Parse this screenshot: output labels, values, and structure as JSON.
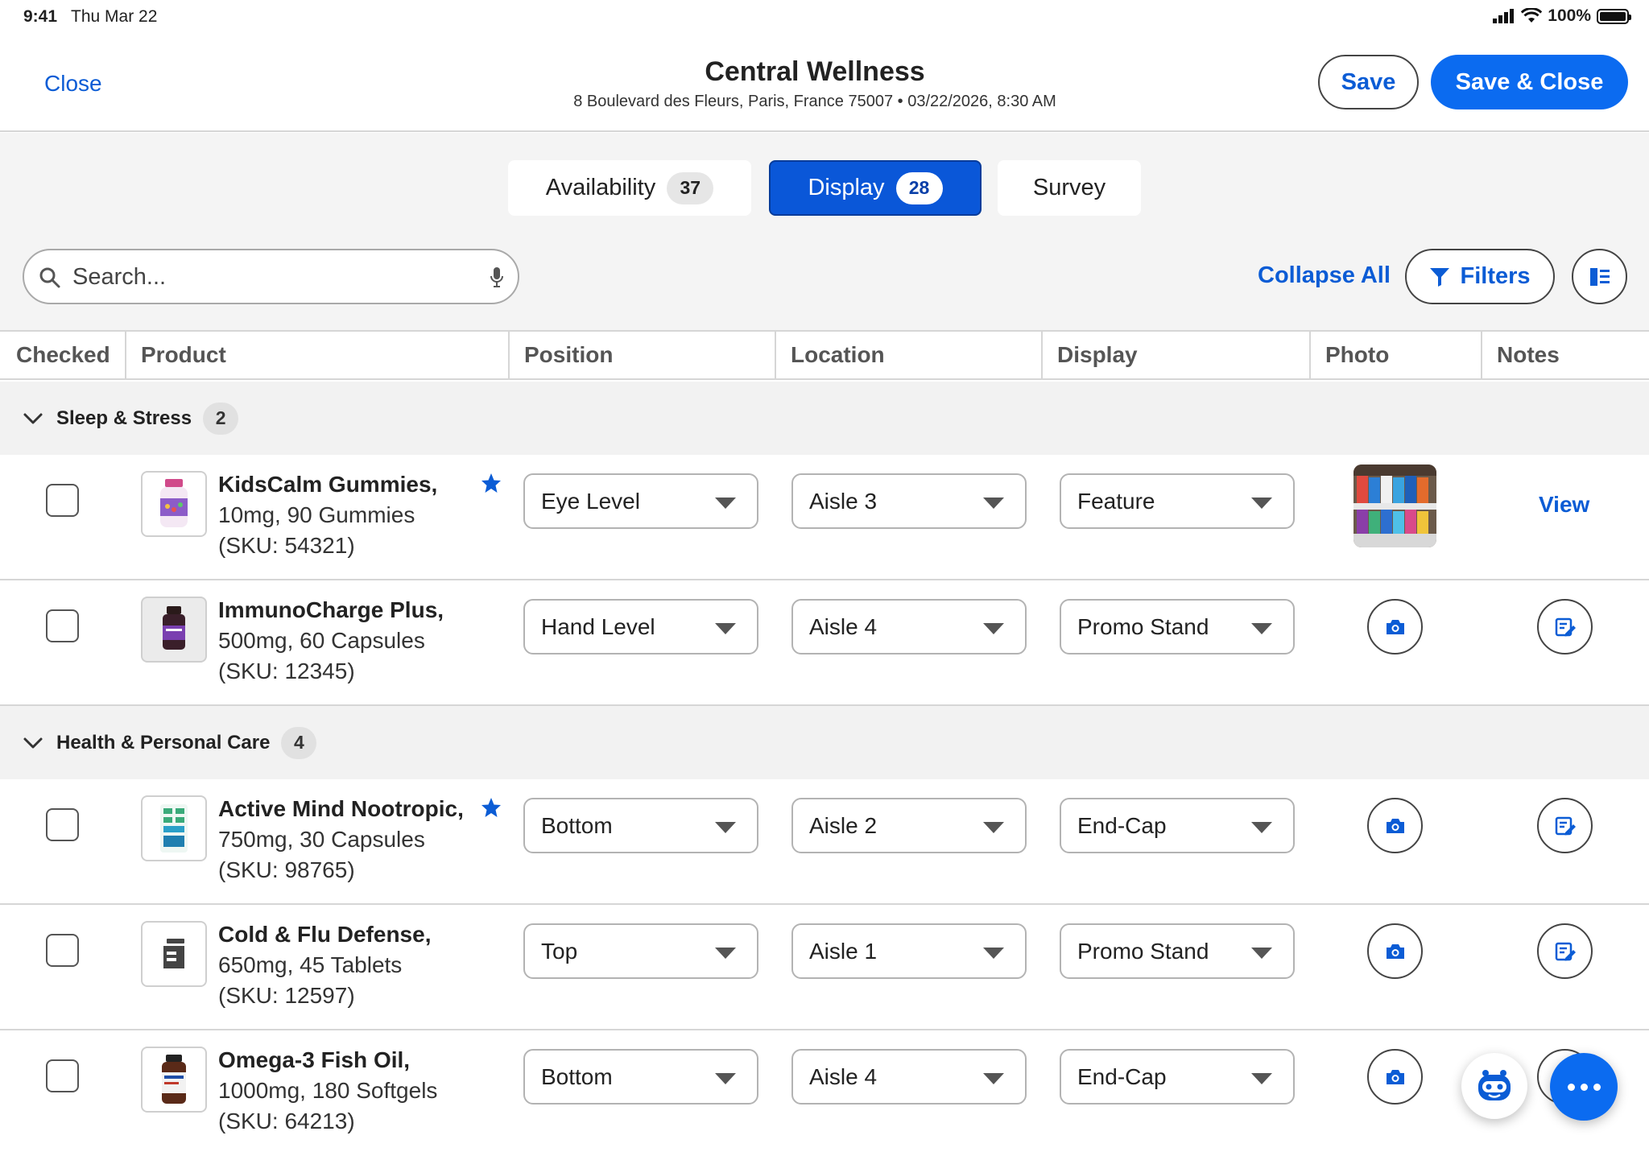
{
  "status": {
    "time": "9:41",
    "date": "Thu Mar 22",
    "battery": "100%"
  },
  "header": {
    "close": "Close",
    "store_name": "Central Wellness",
    "store_sub": "8 Boulevard des Fleurs, Paris, France 75007 • 03/22/2026, 8:30 AM",
    "save": "Save",
    "save_close": "Save & Close"
  },
  "tabs": [
    {
      "label": "Availability",
      "count": "37",
      "active": false
    },
    {
      "label": "Display",
      "count": "28",
      "active": true
    },
    {
      "label": "Survey",
      "count": "",
      "active": false
    }
  ],
  "toolbar": {
    "search_placeholder": "Search...",
    "collapse_all": "Collapse All",
    "filters": "Filters"
  },
  "columns": [
    "Checked",
    "Product",
    "Position",
    "Location",
    "Display",
    "Photo",
    "Notes"
  ],
  "groups": [
    {
      "name": "Sleep & Stress",
      "count": "2",
      "rows": [
        {
          "name": "KidsCalm Gummies,",
          "detail": "10mg, 90 Gummies",
          "sku": "(SKU: 54321)",
          "starred": true,
          "position": "Eye Level",
          "location": "Aisle 3",
          "display": "Feature",
          "photo": "taken",
          "notes": "View"
        },
        {
          "name": "ImmunoCharge Plus,",
          "detail": "500mg, 60 Capsules",
          "sku": "(SKU: 12345)",
          "starred": false,
          "position": "Hand Level",
          "location": "Aisle 4",
          "display": "Promo Stand",
          "photo": "camera-icon",
          "notes": "note-edit-icon"
        }
      ]
    },
    {
      "name": "Health & Personal Care",
      "count": "4",
      "rows": [
        {
          "name": "Active Mind Nootropic,",
          "detail": "750mg, 30 Capsules",
          "sku": "(SKU: 98765)",
          "starred": true,
          "position": "Bottom",
          "location": "Aisle 2",
          "display": "End-Cap",
          "photo": "camera-icon",
          "notes": "note-edit-icon"
        },
        {
          "name": "Cold & Flu Defense,",
          "detail": "650mg, 45 Tablets",
          "sku": "(SKU: 12597)",
          "starred": false,
          "position": "Top",
          "location": "Aisle 1",
          "display": "Promo Stand",
          "photo": "camera-icon",
          "notes": "note-edit-icon"
        },
        {
          "name": "Omega-3 Fish Oil,",
          "detail": "1000mg, 180 Softgels",
          "sku": "(SKU: 64213)",
          "starred": false,
          "position": "Bottom",
          "location": "Aisle 4",
          "display": "End-Cap",
          "photo": "camera-icon",
          "notes": "note-edit-icon"
        }
      ]
    }
  ],
  "colors": {
    "accent": "#0b6bf0",
    "accent_dark": "#0a57d8",
    "link": "#0b5cd5",
    "group_bg": "#f2f2f2",
    "border": "#d6d6d6"
  }
}
